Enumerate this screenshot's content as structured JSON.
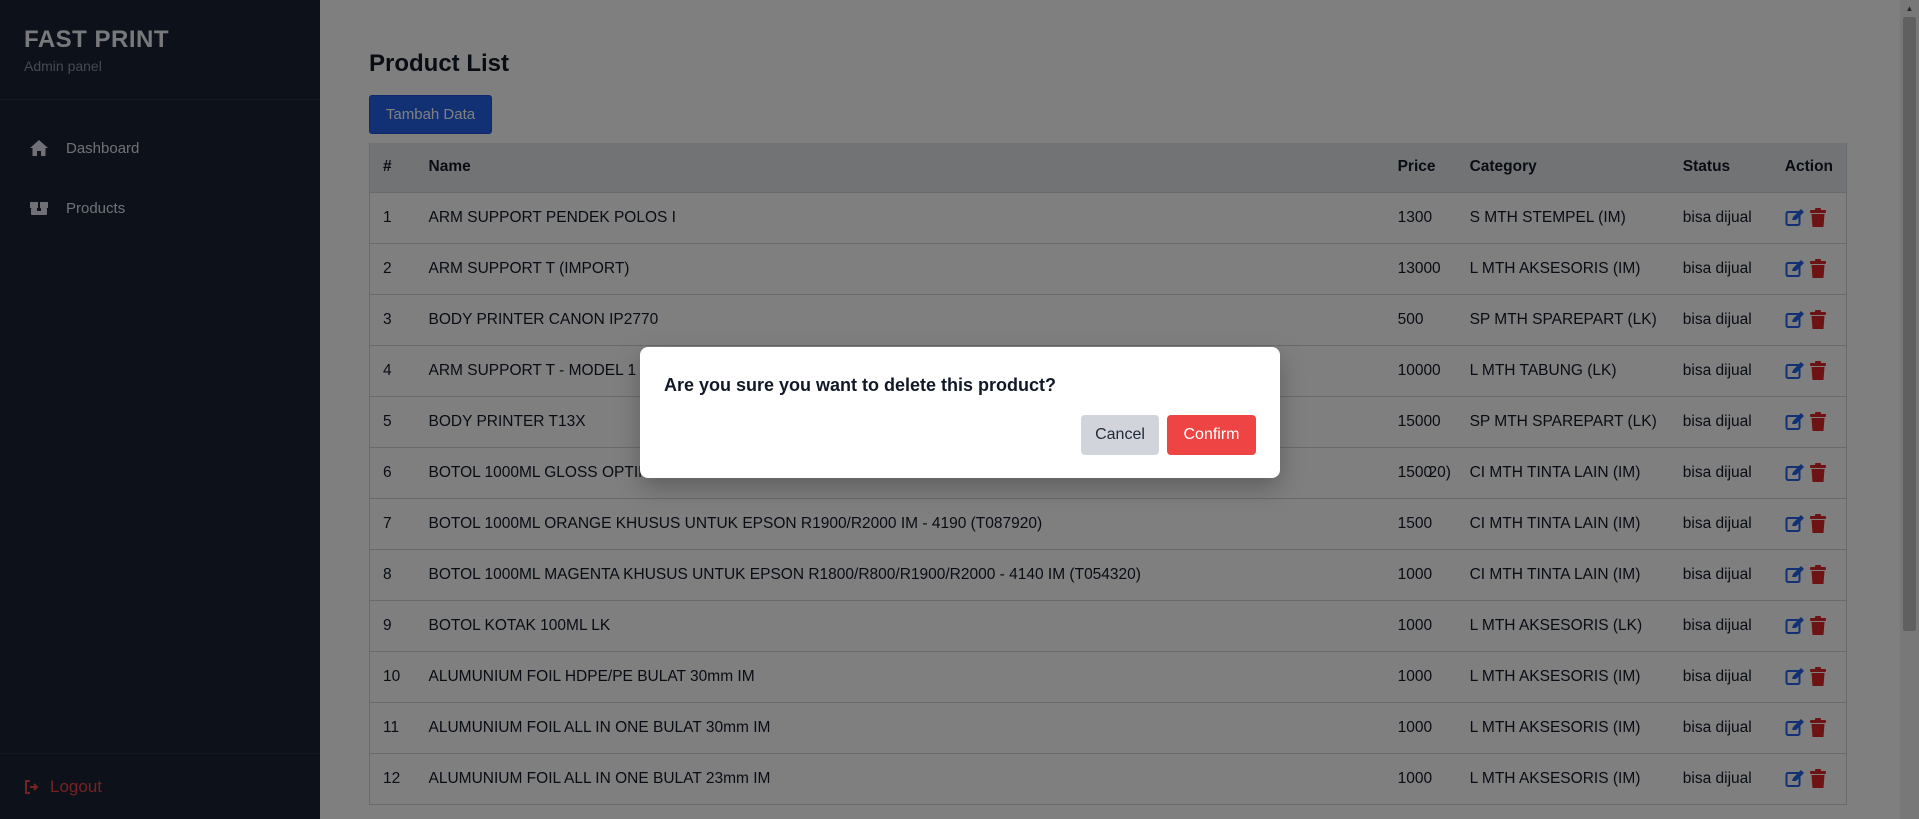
{
  "colors": {
    "sidebar_bg": "#1a2234",
    "primary": "#2563eb",
    "danger": "#ef4444",
    "header_bg": "#e5e7eb"
  },
  "sidebar": {
    "title": "FAST PRINT",
    "subtitle": "Admin panel",
    "items": [
      {
        "label": "Dashboard",
        "icon": "home-icon"
      },
      {
        "label": "Products",
        "icon": "boxes-icon"
      }
    ],
    "logout_label": "Logout"
  },
  "main": {
    "title": "Product List",
    "add_button": "Tambah Data",
    "table": {
      "headers": [
        "#",
        "Name",
        "Price",
        "Category",
        "Status",
        "Action"
      ],
      "rows": [
        {
          "no": "1",
          "name": "ARM SUPPORT PENDEK POLOS I",
          "price": "1300",
          "category": "S MTH STEMPEL (IM)",
          "status": "bisa dijual"
        },
        {
          "no": "2",
          "name": "ARM SUPPORT T (IMPORT)",
          "price": "13000",
          "category": "L MTH AKSESORIS (IM)",
          "status": "bisa dijual"
        },
        {
          "no": "3",
          "name": "BODY PRINTER CANON IP2770",
          "price": "500",
          "category": "SP MTH SPAREPART (LK)",
          "status": "bisa dijual"
        },
        {
          "no": "4",
          "name": "ARM SUPPORT T - MODEL 1 (",
          "price": "10000",
          "category": "L MTH TABUNG (LK)",
          "status": "bisa dijual"
        },
        {
          "no": "5",
          "name": "BODY PRINTER T13X",
          "price": "15000",
          "category": "SP MTH SPAREPART (LK)",
          "status": "bisa dijual"
        },
        {
          "no": "6",
          "name": "BOTOL 1000ML GLOSS OPTIMI",
          "name_tail": "20)",
          "price": "1500",
          "category": "CI MTH TINTA LAIN (IM)",
          "status": "bisa dijual"
        },
        {
          "no": "7",
          "name": "BOTOL 1000ML ORANGE KHUSUS UNTUK EPSON R1900/R2000 IM - 4190 (T087920)",
          "price": "1500",
          "category": "CI MTH TINTA LAIN (IM)",
          "status": "bisa dijual"
        },
        {
          "no": "8",
          "name": "BOTOL 1000ML MAGENTA KHUSUS UNTUK EPSON R1800/R800/R1900/R2000 - 4140 IM (T054320)",
          "price": "1000",
          "category": "CI MTH TINTA LAIN (IM)",
          "status": "bisa dijual"
        },
        {
          "no": "9",
          "name": "BOTOL KOTAK 100ML LK",
          "price": "1000",
          "category": "L MTH AKSESORIS (LK)",
          "status": "bisa dijual"
        },
        {
          "no": "10",
          "name": "ALUMUNIUM FOIL HDPE/PE BULAT 30mm IM",
          "price": "1000",
          "category": "L MTH AKSESORIS (IM)",
          "status": "bisa dijual"
        },
        {
          "no": "11",
          "name": "ALUMUNIUM FOIL ALL IN ONE BULAT 30mm IM",
          "price": "1000",
          "category": "L MTH AKSESORIS (IM)",
          "status": "bisa dijual"
        },
        {
          "no": "12",
          "name": "ALUMUNIUM FOIL ALL IN ONE BULAT 23mm IM",
          "price": "1000",
          "category": "L MTH AKSESORIS (IM)",
          "status": "bisa dijual"
        }
      ]
    }
  },
  "modal": {
    "message": "Are you sure you want to delete this product?",
    "cancel_label": "Cancel",
    "confirm_label": "Confirm"
  }
}
